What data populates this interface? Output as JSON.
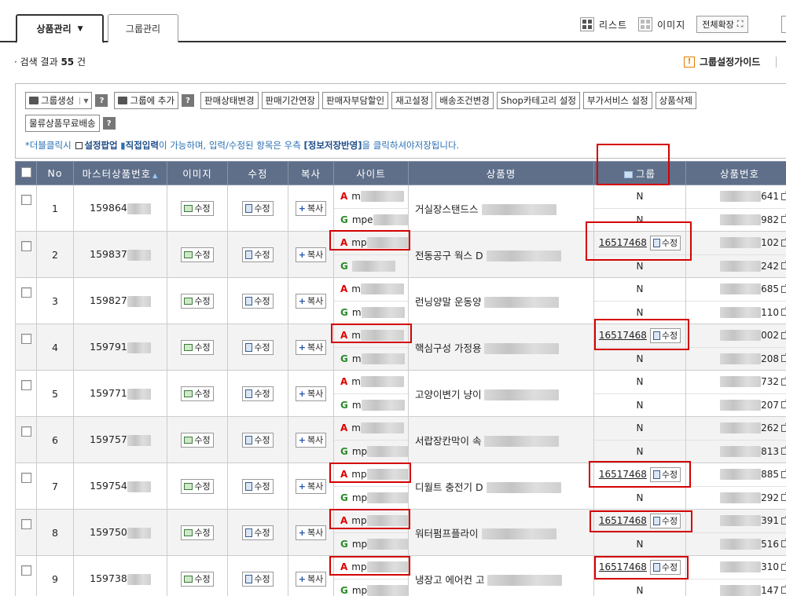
{
  "tabs": [
    {
      "label": "상품관리",
      "active": true
    },
    {
      "label": "그룹관리",
      "active": false
    }
  ],
  "view": {
    "list_label": "리스트",
    "image_label": "이미지",
    "expand_label": "전체확장"
  },
  "search": {
    "prefix": "검색 결과",
    "count": "55",
    "suffix": "건"
  },
  "guide_label": "그룹설정가이드",
  "toolbar": {
    "row1": [
      "그룹생성",
      "그룹에 추가",
      "판매상태변경",
      "판매기간연장",
      "판매자부담할인",
      "재고설정",
      "배송조건변경",
      "Shop카테고리 설정",
      "부가서비스 설정",
      "상품삭제"
    ],
    "row2": [
      "물류상품무료배송"
    ],
    "help": "?",
    "hint_pre": "*더블클릭시",
    "hint_popup": "설정팝업",
    "hint_direct": "직접입력",
    "hint_mid": "이 가능하며, 입력/수정된 항목은 우측",
    "hint_save": "[정보저장반영]",
    "hint_post": "을 클릭하셔야저장됩니다."
  },
  "columns": [
    "No",
    "마스터상품번호",
    "이미지",
    "수정",
    "복사",
    "사이트",
    "상품명",
    "그룹",
    "상품번호"
  ],
  "labels": {
    "edit": "수정",
    "copy": "복사",
    "site_a": "A",
    "site_g": "G",
    "site_prefix": "m",
    "group_none": "N"
  },
  "rows": [
    {
      "no": "1",
      "master": "159864",
      "site_a": "m",
      "site_g": "mpe",
      "name": "거실장스탠드스",
      "group": "",
      "p1": "641",
      "p2": "982"
    },
    {
      "no": "2",
      "master": "159837",
      "site_a": "mp",
      "site_g": "",
      "name": "전동공구 웍스 D",
      "group": "16517468",
      "p1": "102",
      "p2": "242"
    },
    {
      "no": "3",
      "master": "159827",
      "site_a": "m",
      "site_g": "m",
      "name": "런닝양말 운동양",
      "group": "",
      "p1": "685",
      "p2": "110"
    },
    {
      "no": "4",
      "master": "159791",
      "site_a": "m",
      "site_g": "m",
      "name": "핵심구성 가정용",
      "group": "16517468",
      "p1": "002",
      "p2": "208"
    },
    {
      "no": "5",
      "master": "159771",
      "site_a": "m",
      "site_g": "m",
      "name": "고양이변기 냥이",
      "group": "",
      "p1": "732",
      "p2": "207"
    },
    {
      "no": "6",
      "master": "159757",
      "site_a": "m",
      "site_g": "mp",
      "name": "서랍장칸막이 속",
      "group": "",
      "p1": "262",
      "p2": "813"
    },
    {
      "no": "7",
      "master": "159754",
      "site_a": "mp",
      "site_g": "mp",
      "name": "디월트 충전기 D",
      "group": "16517468",
      "p1": "885",
      "p2": "292"
    },
    {
      "no": "8",
      "master": "159750",
      "site_a": "mp",
      "site_g": "mp",
      "name": "워터펌프플라이",
      "group": "16517468",
      "p1": "391",
      "p2": "516"
    },
    {
      "no": "9",
      "master": "159738",
      "site_a": "mp",
      "site_g": "mp",
      "name": "냉장고 에어컨 고",
      "group": "16517468",
      "p1": "310",
      "p2": "147"
    }
  ]
}
